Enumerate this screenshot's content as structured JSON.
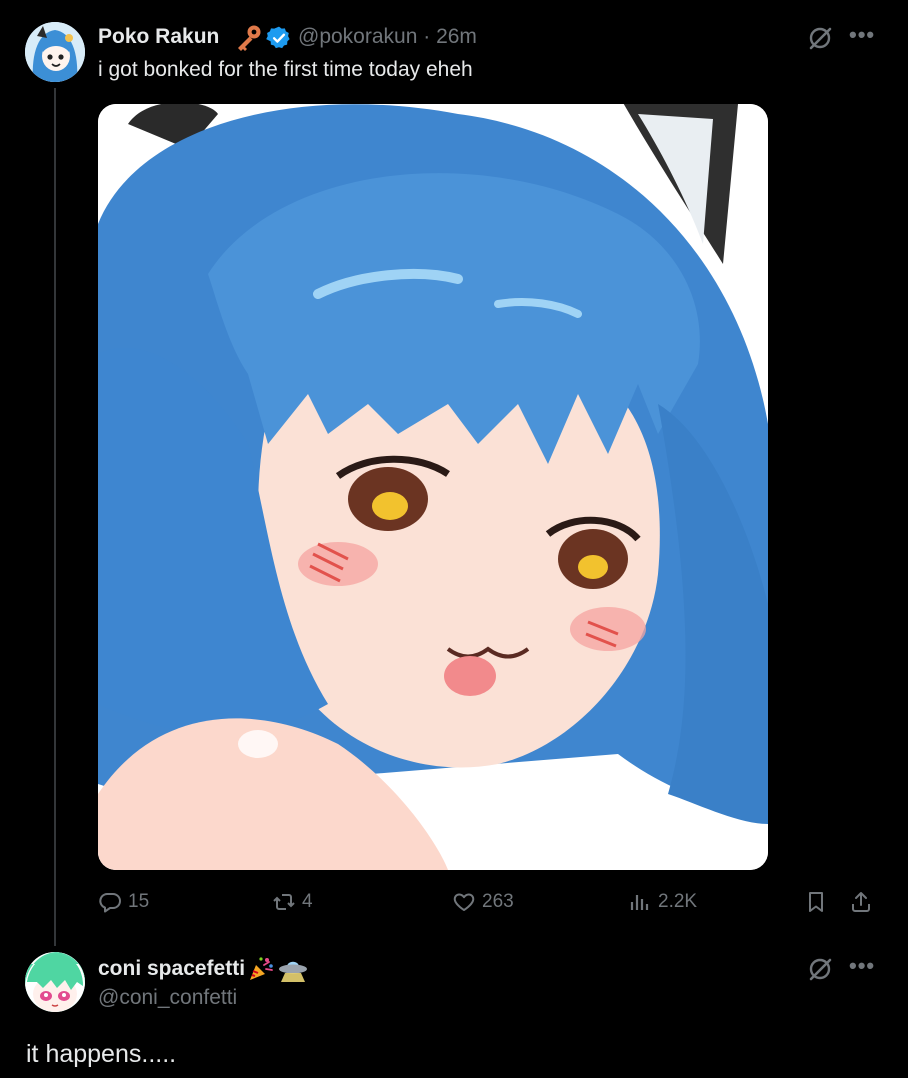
{
  "tweet": {
    "display_name": "Poko Rakun",
    "name_emoji": "key",
    "verified": true,
    "handle": "@pokorakun",
    "time": "26m",
    "text": "i got bonked for the first time today eheh",
    "media_alt": "anime girl with blue hair and cat ears",
    "actions": {
      "replies": "15",
      "retweets": "4",
      "likes": "263",
      "views": "2.2K"
    }
  },
  "reply": {
    "display_name": "coni spacefetti",
    "name_emojis": [
      "party-popper",
      "flying-saucer"
    ],
    "handle": "@coni_confetti",
    "text": "it happens....."
  },
  "colors": {
    "background": "#000000",
    "primary_text": "#e7e9ea",
    "secondary_text": "#71767b",
    "verified_blue": "#1d9bf0",
    "thread_line": "#333639"
  },
  "icons": [
    "grok-icon",
    "more-icon",
    "reply-icon",
    "retweet-icon",
    "like-icon",
    "views-icon",
    "bookmark-icon",
    "share-icon"
  ]
}
